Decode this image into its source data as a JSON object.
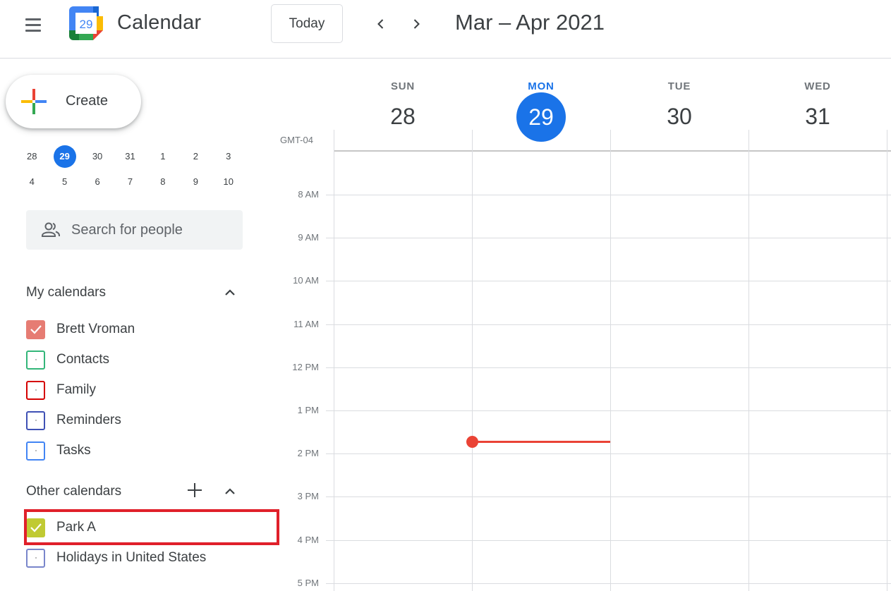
{
  "header": {
    "app_title": "Calendar",
    "logo_day": "29",
    "today_label": "Today",
    "date_range": "Mar – Apr 2021"
  },
  "create": {
    "label": "Create"
  },
  "mini_calendar": {
    "weeks": [
      [
        {
          "d": "28"
        },
        {
          "d": "29",
          "today": true
        },
        {
          "d": "30"
        },
        {
          "d": "31"
        },
        {
          "d": "1"
        },
        {
          "d": "2"
        },
        {
          "d": "3"
        }
      ],
      [
        {
          "d": "4"
        },
        {
          "d": "5"
        },
        {
          "d": "6"
        },
        {
          "d": "7"
        },
        {
          "d": "8"
        },
        {
          "d": "9"
        },
        {
          "d": "10"
        }
      ]
    ]
  },
  "search_people": {
    "placeholder": "Search for people"
  },
  "my_calendars": {
    "title": "My calendars",
    "items": [
      {
        "name": "Brett Vroman",
        "color": "#e67c73",
        "checked": true
      },
      {
        "name": "Contacts",
        "color": "#33b679",
        "checked": false
      },
      {
        "name": "Family",
        "color": "#d50000",
        "checked": false
      },
      {
        "name": "Reminders",
        "color": "#3f51b5",
        "checked": false
      },
      {
        "name": "Tasks",
        "color": "#4285f4",
        "checked": false
      }
    ]
  },
  "other_calendars": {
    "title": "Other calendars",
    "items": [
      {
        "name": "Park A",
        "color": "#c0ca33",
        "checked": true
      },
      {
        "name": "Holidays in United States",
        "color": "#7986cb",
        "checked": false
      }
    ]
  },
  "grid": {
    "timezone": "GMT-04",
    "days": [
      {
        "dow": "SUN",
        "num": "28",
        "today": false
      },
      {
        "dow": "MON",
        "num": "29",
        "today": true
      },
      {
        "dow": "TUE",
        "num": "30",
        "today": false
      },
      {
        "dow": "WED",
        "num": "31",
        "today": false
      }
    ],
    "hours": [
      "8 AM",
      "9 AM",
      "10 AM",
      "11 AM",
      "12 PM",
      "1 PM",
      "2 PM",
      "3 PM",
      "4 PM",
      "5 PM"
    ]
  },
  "colors": {
    "accent": "#1a73e8",
    "now_indicator": "#ea4335",
    "highlight_box": "#e0202a"
  }
}
